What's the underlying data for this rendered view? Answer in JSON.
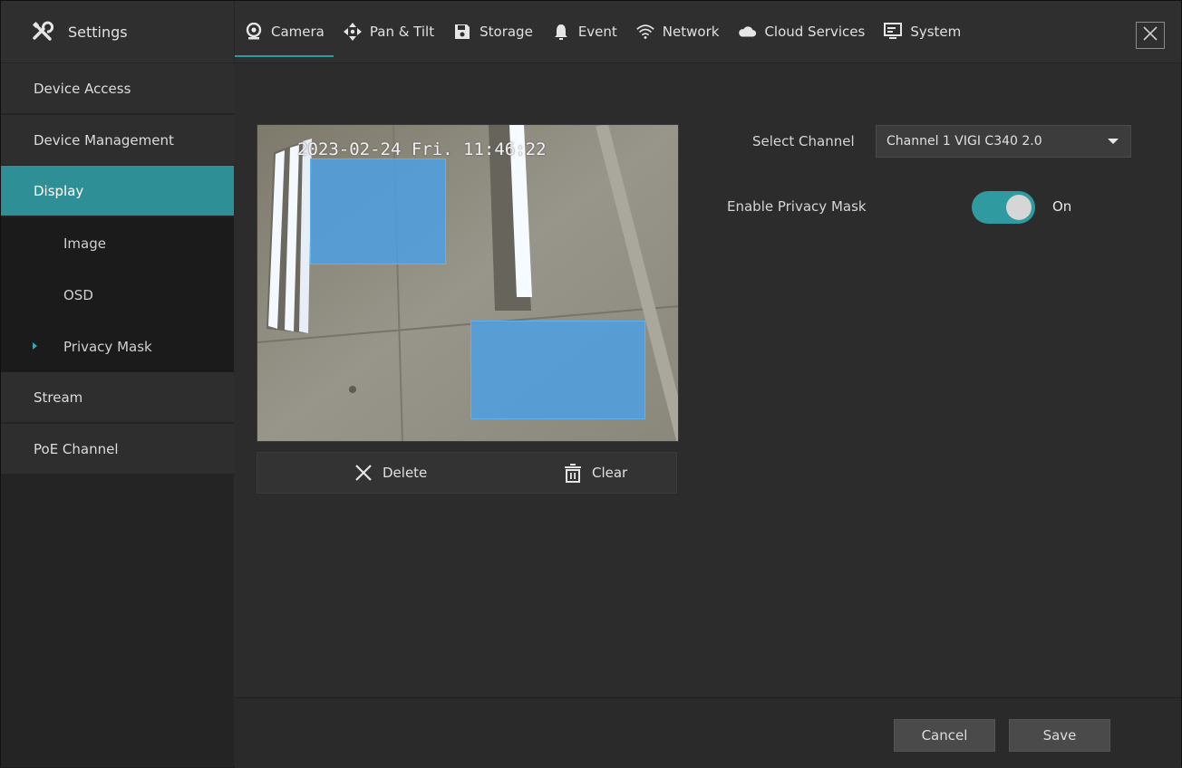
{
  "header": {
    "settings_label": "Settings",
    "tabs": [
      {
        "label": "Camera",
        "icon": "camera-icon",
        "active": true
      },
      {
        "label": "Pan & Tilt",
        "icon": "pan-tilt-icon"
      },
      {
        "label": "Storage",
        "icon": "storage-icon"
      },
      {
        "label": "Event",
        "icon": "bell-icon"
      },
      {
        "label": "Network",
        "icon": "wifi-icon"
      },
      {
        "label": "Cloud Services",
        "icon": "cloud-icon"
      },
      {
        "label": "System",
        "icon": "monitor-icon"
      }
    ],
    "close_icon": "close-icon"
  },
  "sidebar": {
    "items": [
      {
        "label": "Device Access"
      },
      {
        "label": "Device Management"
      },
      {
        "label": "Display",
        "active": true
      },
      {
        "label": "Image"
      },
      {
        "label": "OSD"
      },
      {
        "label": "Privacy Mask",
        "current": true
      },
      {
        "label": "Stream"
      },
      {
        "label": "PoE Channel"
      }
    ]
  },
  "preview": {
    "timestamp": "2023-02-24 Fri. 11:46:22",
    "mask_count": 2
  },
  "actions": {
    "delete_label": "Delete",
    "clear_label": "Clear"
  },
  "form": {
    "channel_label": "Select Channel",
    "channel_value": "Channel 1 VIGI C340 2.0",
    "privacy_label": "Enable Privacy Mask",
    "privacy_state": "On",
    "privacy_enabled": true
  },
  "footer": {
    "cancel_label": "Cancel",
    "save_label": "Save"
  },
  "colors": {
    "accent": "#2e8f96",
    "mask": "#4ea0e1",
    "background": "#2c2c2c"
  }
}
